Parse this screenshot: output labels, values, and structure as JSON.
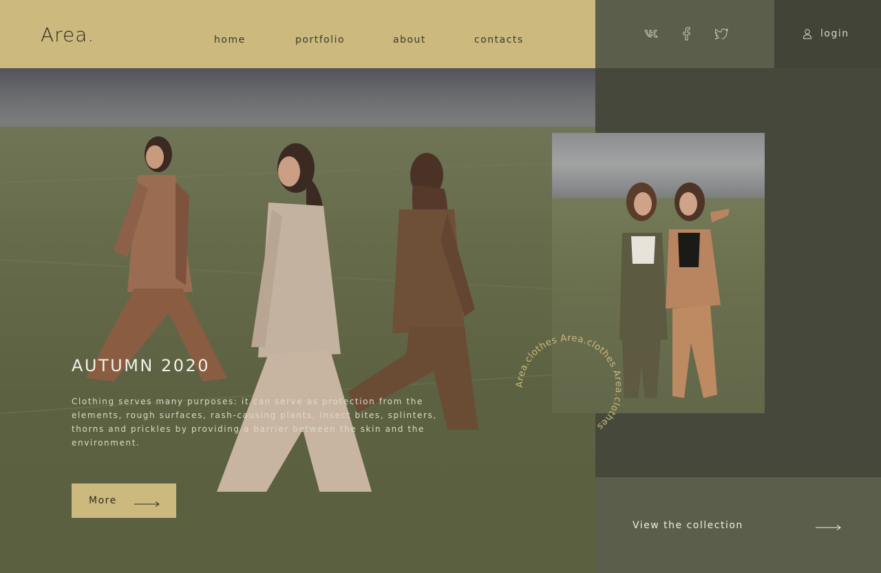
{
  "header": {
    "logo": "Area.",
    "nav": [
      {
        "label": "home"
      },
      {
        "label": "portfolio"
      },
      {
        "label": "about"
      },
      {
        "label": "contacts"
      }
    ],
    "social_icons": [
      "vk-icon",
      "facebook-icon",
      "twitter-icon"
    ],
    "login_label": "login"
  },
  "hero": {
    "title": "AUTUMN 2020",
    "description": "Clothing serves many purposes: it can serve as protection from the elements, rough surfaces, rash-causing plants, insect bites, splinters, thorns and prickles by providing a barrier between the skin and the environment.",
    "more_label": "More"
  },
  "side": {
    "circle_text": "Area.clothes Area.clothes Area.clothes ",
    "collection_label": "View the collection"
  },
  "colors": {
    "accent": "#cbb97d",
    "dark_olive": "#45483a",
    "olive": "#5a5e4b",
    "login_bg": "#414436"
  }
}
